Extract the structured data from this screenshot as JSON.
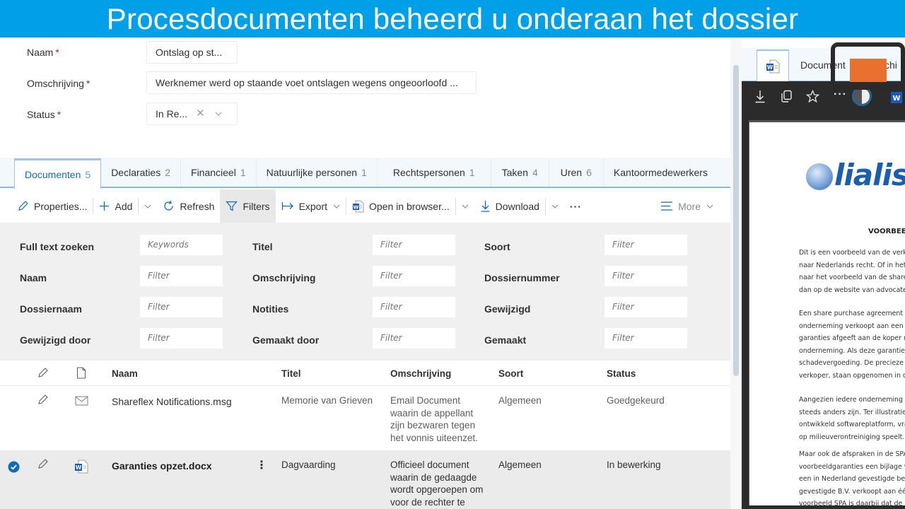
{
  "banner": {
    "title": "Procesdocumenten beheerd u onderaan het dossier"
  },
  "form": {
    "naam": {
      "label": "Naam",
      "required_mark": "*",
      "value": "Ontslag op st..."
    },
    "omschrijving": {
      "label": "Omschrijving",
      "required_mark": "*",
      "value": "Werknemer werd op staande voet ontslagen wegens ongeoorloofd ..."
    },
    "status": {
      "label": "Status",
      "required_mark": "*",
      "value": "In Re...",
      "clear_glyph": "✕"
    }
  },
  "tabs": [
    {
      "label": "Documenten",
      "count": "5",
      "active": true
    },
    {
      "label": "Declaraties",
      "count": "2"
    },
    {
      "label": "Financieel",
      "count": "1"
    },
    {
      "label": "Natuurlijke personen",
      "count": "1"
    },
    {
      "label": "Rechtspersonen",
      "count": "1"
    },
    {
      "label": "Taken",
      "count": "4"
    },
    {
      "label": "Uren",
      "count": "6"
    },
    {
      "label": "Kantoormedewerkers",
      "count": ""
    }
  ],
  "toolbar": {
    "properties": "Properties...",
    "add": "Add",
    "refresh": "Refresh",
    "filters": "Filters",
    "export": "Export",
    "open_in_browser": "Open in browser...",
    "download": "Download",
    "overflow": "···",
    "more": "More",
    "accent": "#0f6cbd"
  },
  "filters": {
    "col1": [
      {
        "label": "Full text zoeken",
        "placeholder": "Keywords"
      },
      {
        "label": "Naam",
        "placeholder": "Filter"
      },
      {
        "label": "Dossiernaam",
        "placeholder": "Filter"
      },
      {
        "label": "Gewijzigd door",
        "placeholder": "Filter"
      }
    ],
    "col2": [
      {
        "label": "Titel",
        "placeholder": "Filter"
      },
      {
        "label": "Omschrijving",
        "placeholder": "Filter"
      },
      {
        "label": "Notities",
        "placeholder": "Filter"
      },
      {
        "label": "Gemaakt door",
        "placeholder": "Filter"
      }
    ],
    "col3": [
      {
        "label": "Soort",
        "placeholder": "Filter"
      },
      {
        "label": "Dossiernummer",
        "placeholder": "Filter"
      },
      {
        "label": "Gewijzigd",
        "placeholder": "Filter"
      },
      {
        "label": "Gemaakt",
        "placeholder": "Filter"
      }
    ]
  },
  "grid": {
    "columns": {
      "naam": "Naam",
      "titel": "Titel",
      "omschrijving": "Omschrijving",
      "soort": "Soort",
      "status": "Status"
    },
    "rows": [
      {
        "file_icon": "email-icon",
        "naam": "Shareflex Notifications.msg",
        "titel": "Memorie van Grieven",
        "omschrijving": [
          "Email Document",
          "waarin de appellant",
          "zijn bezwaren tegen",
          "het vonnis uiteenzet."
        ],
        "soort": "Algemeen",
        "status": "Goedgekeurd",
        "selected": false
      },
      {
        "file_icon": "word-document-icon",
        "naam": "Garanties opzet.docx",
        "titel": "Dagvaarding",
        "omschrijving": [
          "Officieel document",
          "waarin de gedaagde",
          "wordt opgeroepen om",
          "voor de rechter te"
        ],
        "soort": "Algemeen",
        "status": "In bewerking",
        "selected": true,
        "row_menu": "⋮"
      }
    ]
  },
  "preview": {
    "tab_label": "Document",
    "tab_label_2": "chi",
    "logo_text": "lialis",
    "heading": "VOORBEELD G",
    "paragraphs": [
      [
        "Dit is een voorbeeld van de verkop",
        "naar Nederlands recht. Of in het En",
        "naar het voorbeeld van de share pu",
        "dan op de website van advocatenka"
      ],
      [
        "Een share purchase agreement (S",
        "onderneming verkoopt aan een kop",
        "garanties afgeeft aan de koper met",
        "onderneming. Als deze garanties",
        "schadevergoeding. De precieze sch",
        "verkoper, staan opgenomen in de S"
      ],
      [
        "Aangezien iedere onderneming die",
        "steeds anders zijn. Ter illustratie:",
        "ontwikkeld softwareplatform, vraag",
        "op milieuverontreiniging speelt."
      ],
      [
        "Maar ook de afspraken in de SPA",
        "voorbeeldgaranties een bijlage van",
        "een in Nederland gevestigde beslote",
        "gevestigde B.V. verkoopt aan één i",
        "voorbeeld SPA is daarbij dat de B."
      ]
    ]
  }
}
